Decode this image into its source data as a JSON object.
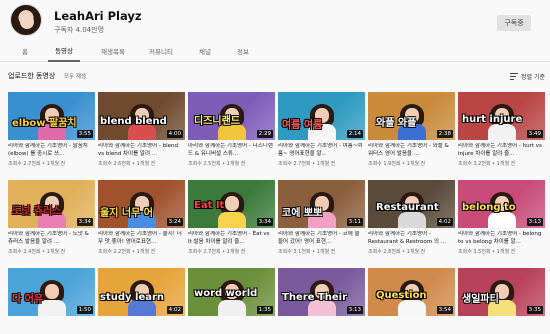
{
  "channel": {
    "name": "LeahAri Playz",
    "subscribers": "구독자 4.04만명",
    "subscribe_label": "구독중"
  },
  "tabs": [
    {
      "label": "홈",
      "active": false
    },
    {
      "label": "동영상",
      "active": true
    },
    {
      "label": "재생목록",
      "active": false
    },
    {
      "label": "커뮤니티",
      "active": false
    },
    {
      "label": "채널",
      "active": false
    },
    {
      "label": "정보",
      "active": false
    }
  ],
  "section": {
    "title": "업로드한 동영상",
    "sub": "모두 재생",
    "sort_label": "정렬 기준"
  },
  "videos": [
    {
      "thumb_text": "elbow 팔꿈치",
      "bg": "#3a8fd1",
      "shirt": "#e06aa8",
      "word_color": "#ffd23a",
      "duration": "3:55",
      "title": "리아와 함께하는 기초영어 - 팔꿈치 (elbow) 를 중시로 쓰...",
      "meta": "조회수 2.7천회 • 1개월 전"
    },
    {
      "thumb_text": "blend blend",
      "bg": "#6f4a2e",
      "shirt": "#d94f4f",
      "word_color": "#ffffff",
      "duration": "4:00",
      "title": "리아와 함께하는 기초영어 - blend vs blend 차이를 알려 ...",
      "meta": "조회수 2.6천회 • 1개월 전"
    },
    {
      "thumb_text": "디즈니랜드",
      "bg": "#7e5db8",
      "shirt": "#f0c43c",
      "word_color": "#ffef6e",
      "duration": "2:29",
      "title": "아리와 함께하는 기초영어 - 디즈니랜드 & 유니버셜 스튜...",
      "meta": "조회수 2.5천회 • 1개월 전"
    },
    {
      "thumb_text": "여름 여름",
      "bg": "#2f9ac0",
      "shirt": "#f6f6f6",
      "word_color": "#ff5a5a",
      "duration": "2:14",
      "title": "리아와 함께하는 기초영어 - 여름~여름~ 영어표현을 알...",
      "meta": "조회수 2.7천회 • 1개월 전"
    },
    {
      "thumb_text": "와플 와플",
      "bg": "#c98a3c",
      "shirt": "#3c6fd4",
      "word_color": "#ffffff",
      "duration": "2:38",
      "title": "리아와 함께하는 기초영어 - 와플 & 워터스 영어 발음을 ...",
      "meta": "조회수 1.9천회 • 1개월 전"
    },
    {
      "thumb_text": "hurt injure",
      "bg": "#b94545",
      "shirt": "#f2f2f2",
      "word_color": "#ffffff",
      "duration": "3:49",
      "title": "리아와 함께하는 기초영어 - hurt vs injure 차이를 알려 줄...",
      "meta": "조회수 3.2천회 • 1개월 전"
    },
    {
      "thumb_text": "도넛 츄러스",
      "bg": "#e0b05a",
      "shirt": "#ea7fb3",
      "word_color": "#d62b2b",
      "duration": "3:34",
      "title": "리아와 함께하는 기초영어 - 도넛 & 츄러스 발음을 알려 ...",
      "meta": "조회수 2.4천회 • 1개월 전"
    },
    {
      "thumb_text": "울지 너무 어",
      "bg": "#a0522d",
      "shirt": "#4a8de0",
      "word_color": "#ffe04a",
      "duration": "3:24",
      "title": "리아와 함께하는 기초영어 - 울지! 너무 맛 좋아! 영어로표현...",
      "meta": "조회수 2.2천회 • 1개월 전"
    },
    {
      "thumb_text": "Eat It",
      "bg": "#3b7a3b",
      "shirt": "#f5d34a",
      "word_color": "#ff4040",
      "duration": "3:34",
      "title": "리아와 함께하는 기초영어 - Eat vs It 발음 차이를 알려 줄...",
      "meta": "조회수 2.7천회 • 1개월 전"
    },
    {
      "thumb_text": "코에 뽀뽀",
      "bg": "#8b5e3c",
      "shirt": "#f0a0c0",
      "word_color": "#ffffff",
      "duration": "3:11",
      "title": "리아와 함께하는 기초영어 - 코에 물 들어 갔어! 영어 표현...",
      "meta": "조회수 3.1천회 • 1개월 전"
    },
    {
      "thumb_text": "Restaurant",
      "bg": "#5a4a3a",
      "shirt": "#d9d9d9",
      "word_color": "#ffffff",
      "duration": "4:02",
      "title": "리아와 함께하는 기초영어 - Restaurant & Restroom 의 ...",
      "meta": "조회수 2.8천회 • 1개월 전"
    },
    {
      "thumb_text": "belong to",
      "bg": "#c84b7a",
      "shirt": "#ffffff",
      "word_color": "#ffe14f",
      "duration": "3:13",
      "title": "리아와 함께하는 기초영어 - belong to vs belong 차이를 알...",
      "meta": "조회수 3.5천회 • 1개월 전"
    },
    {
      "thumb_text": "다 어유",
      "bg": "#4ba3d9",
      "shirt": "#f2f2f2",
      "word_color": "#ff3b3b",
      "duration": "1:50",
      "title": "",
      "meta": ""
    },
    {
      "thumb_text": "study learn",
      "bg": "#e8a43c",
      "shirt": "#5678d9",
      "word_color": "#ffffff",
      "duration": "4:02",
      "title": "",
      "meta": ""
    },
    {
      "thumb_text": "word world",
      "bg": "#6b8f3a",
      "shirt": "#f0f0f0",
      "word_color": "#ffffff",
      "duration": "1:35",
      "title": "",
      "meta": ""
    },
    {
      "thumb_text": "There Their",
      "bg": "#7a5a9c",
      "shirt": "#f2c1d6",
      "word_color": "#ffffff",
      "duration": "3:13",
      "title": "",
      "meta": ""
    },
    {
      "thumb_text": "Question",
      "bg": "#d08a4a",
      "shirt": "#f7f7f7",
      "word_color": "#ffe14f",
      "duration": "3:54",
      "title": "",
      "meta": ""
    },
    {
      "thumb_text": "생일파티",
      "bg": "#b8425a",
      "shirt": "#f6e07a",
      "word_color": "#ffffff",
      "duration": "3:35",
      "title": "",
      "meta": ""
    }
  ]
}
